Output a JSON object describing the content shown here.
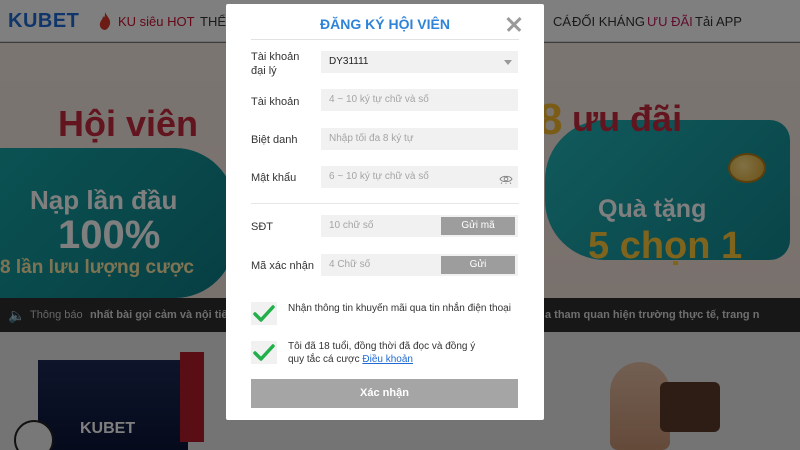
{
  "background": {
    "logo": "KUBET",
    "nav": {
      "hot": "KU siêu HOT",
      "the": "THỂ",
      "ca": "CÁ",
      "doi_khang": "ĐỐI KHÁNG",
      "uu_dai": "ƯU ĐÃI",
      "app": "Tải APP"
    },
    "banner": {
      "title_left": "Hội viên",
      "title_right": "ưu đãi",
      "num": "8",
      "promo_line1": "Nạp lần đầu",
      "promo_line2": "100%",
      "promo_line3": "8 lần lưu lượng cược",
      "gift_line1": "Quà tặng",
      "gift_line2": "5 chọn 1"
    },
    "notice": {
      "label": "Thông báo",
      "text_left": "nhất bài gọi cảm và nội tiếng",
      "text_right": "a tham quan hiện trường thực tế, trang n"
    },
    "panel_logo": "KUBET"
  },
  "modal": {
    "title": "ĐĂNG KÝ HỘI VIÊN",
    "fields": {
      "agent": {
        "label": "Tài khoản đại lý",
        "value": "DY31111"
      },
      "account": {
        "label": "Tài khoản",
        "placeholder": "4 ~ 10 ký tự chữ và số"
      },
      "nickname": {
        "label": "Biệt danh",
        "placeholder": "Nhập tối đa 8 ký tự"
      },
      "password": {
        "label": "Mật khẩu",
        "placeholder": "6 ~ 10 ký tự chữ và số"
      },
      "phone": {
        "label": "SĐT",
        "placeholder": "10 chữ số",
        "button": "Gửi mã"
      },
      "code": {
        "label": "Mã xác nhận",
        "placeholder": "4 Chữ số",
        "button": "Gửi"
      }
    },
    "checks": {
      "promo": {
        "text": "Nhận thông tin khuyến mãi qua tin nhắn điện thoại",
        "checked": true
      },
      "terms": {
        "text": "Tôi đã 18 tuổi, đồng thời đã đọc và đồng ý quy tắc cá cược ",
        "link": "Điều khoản",
        "checked": true
      }
    },
    "submit": "Xác nhận"
  },
  "colors": {
    "accent": "#2f83d8",
    "check": "#22b04b",
    "button_gray": "#9d9d9d"
  }
}
